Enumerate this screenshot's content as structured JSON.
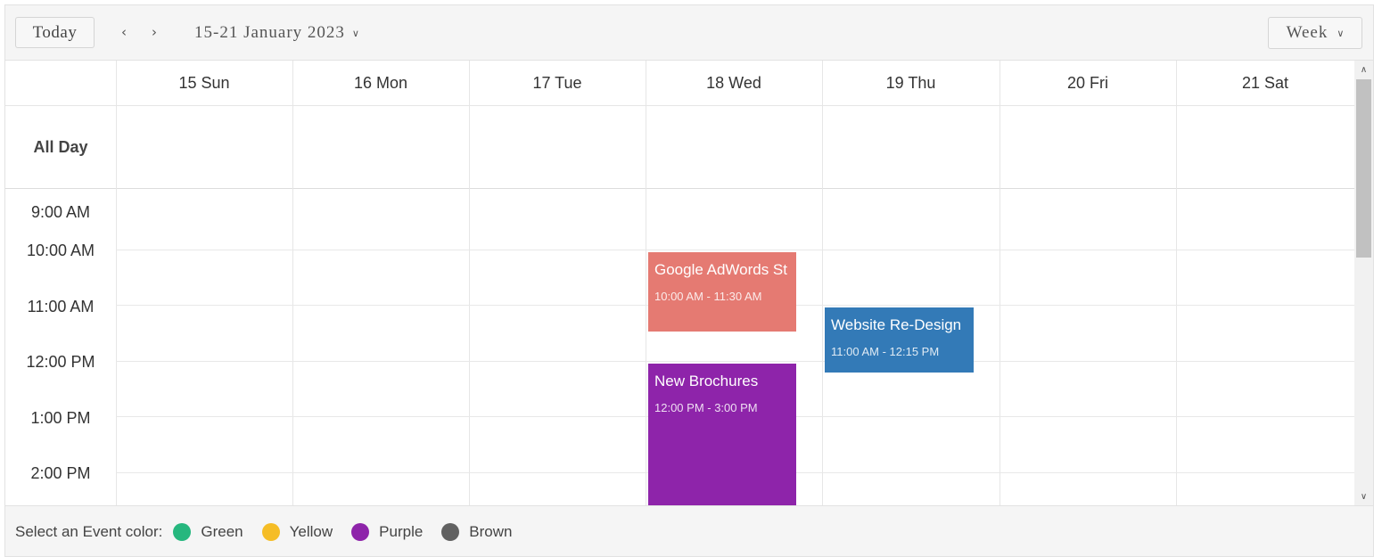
{
  "toolbar": {
    "today_label": "Today",
    "prev_icon": "chevron-left-icon",
    "next_icon": "chevron-right-icon",
    "date_range": "15-21 January 2023",
    "view_label": "Week"
  },
  "days": [
    {
      "label": "15 Sun"
    },
    {
      "label": "16 Mon"
    },
    {
      "label": "17 Tue"
    },
    {
      "label": "18 Wed"
    },
    {
      "label": "19 Thu"
    },
    {
      "label": "20 Fri"
    },
    {
      "label": "21 Sat"
    }
  ],
  "all_day_label": "All Day",
  "times": [
    "9:00 AM",
    "10:00 AM",
    "11:00 AM",
    "12:00 PM",
    "1:00 PM",
    "2:00 PM"
  ],
  "events": [
    {
      "title": "Google AdWords St",
      "time": "10:00 AM - 11:30 AM",
      "day": "18 Wed",
      "color": "#e57a72"
    },
    {
      "title": "Website Re-Design",
      "time": "11:00 AM - 12:15 PM",
      "day": "19 Thu",
      "color": "#337ab7"
    },
    {
      "title": "New Brochures",
      "time": "12:00 PM - 3:00 PM",
      "day": "18 Wed",
      "color": "#8e24aa"
    }
  ],
  "footer": {
    "label": "Select an Event color:",
    "colors": [
      {
        "name": "Green",
        "hex": "#26b77e"
      },
      {
        "name": "Yellow",
        "hex": "#f5bd26"
      },
      {
        "name": "Purple",
        "hex": "#8e24aa"
      },
      {
        "name": "Brown",
        "hex": "#616161"
      }
    ]
  }
}
